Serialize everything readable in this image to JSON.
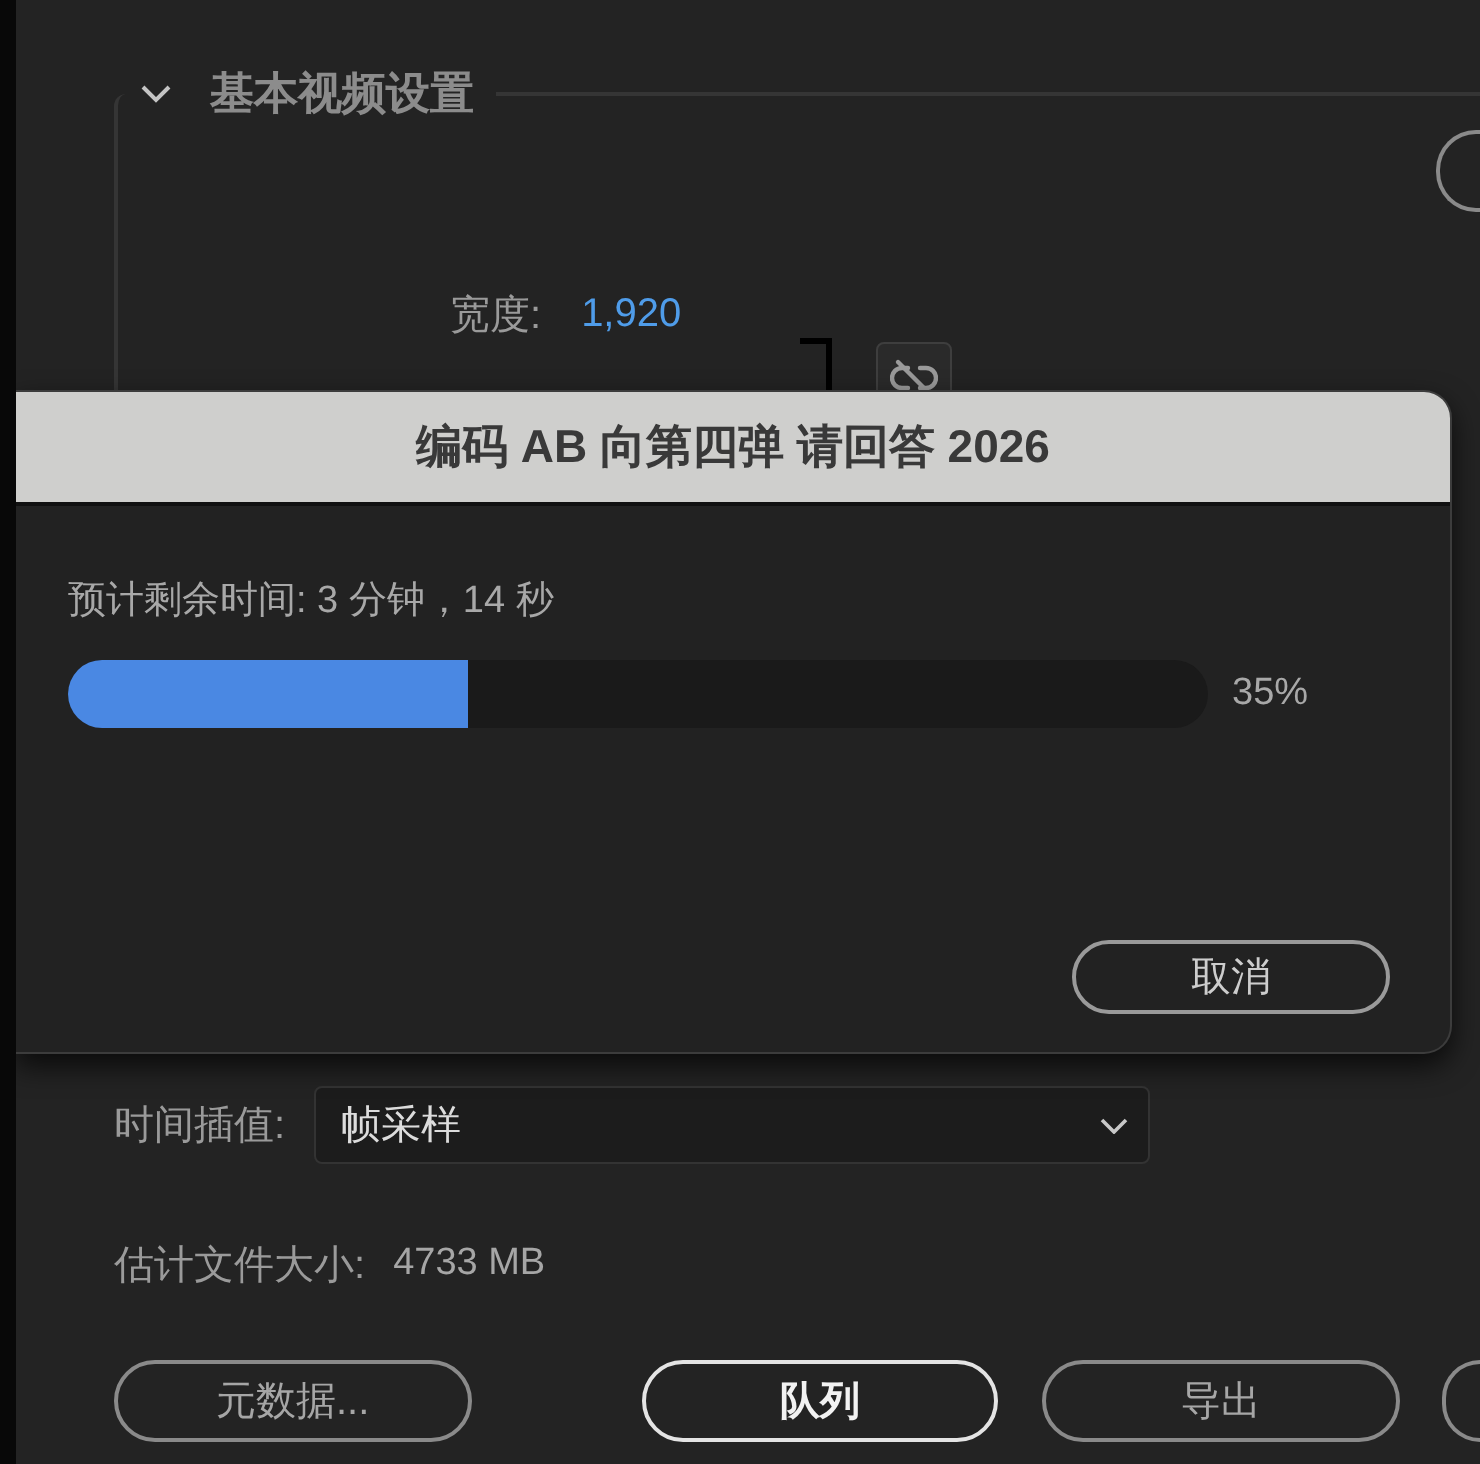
{
  "section": {
    "title": "基本视频设置",
    "expanded": true,
    "fields": [
      {
        "label": "宽度:",
        "value": "1,920"
      }
    ]
  },
  "dialog": {
    "title": "编码 AB 向第四弹 请回答 2026",
    "status": "预计剩余时间: 3 分钟，14 秒",
    "progress": {
      "level": 0.35,
      "reading": "35%"
    },
    "buttons": [
      {
        "label": "取消"
      }
    ]
  },
  "interpolation": {
    "label": "时间插值:",
    "value": "帧采样"
  },
  "file_size": {
    "label": "估计文件大小:",
    "value": "4733 MB"
  },
  "buttons": [
    {
      "label": "元数据...",
      "default": false
    },
    {
      "label": "队列",
      "default": true
    },
    {
      "label": "导出",
      "default": false
    }
  ]
}
